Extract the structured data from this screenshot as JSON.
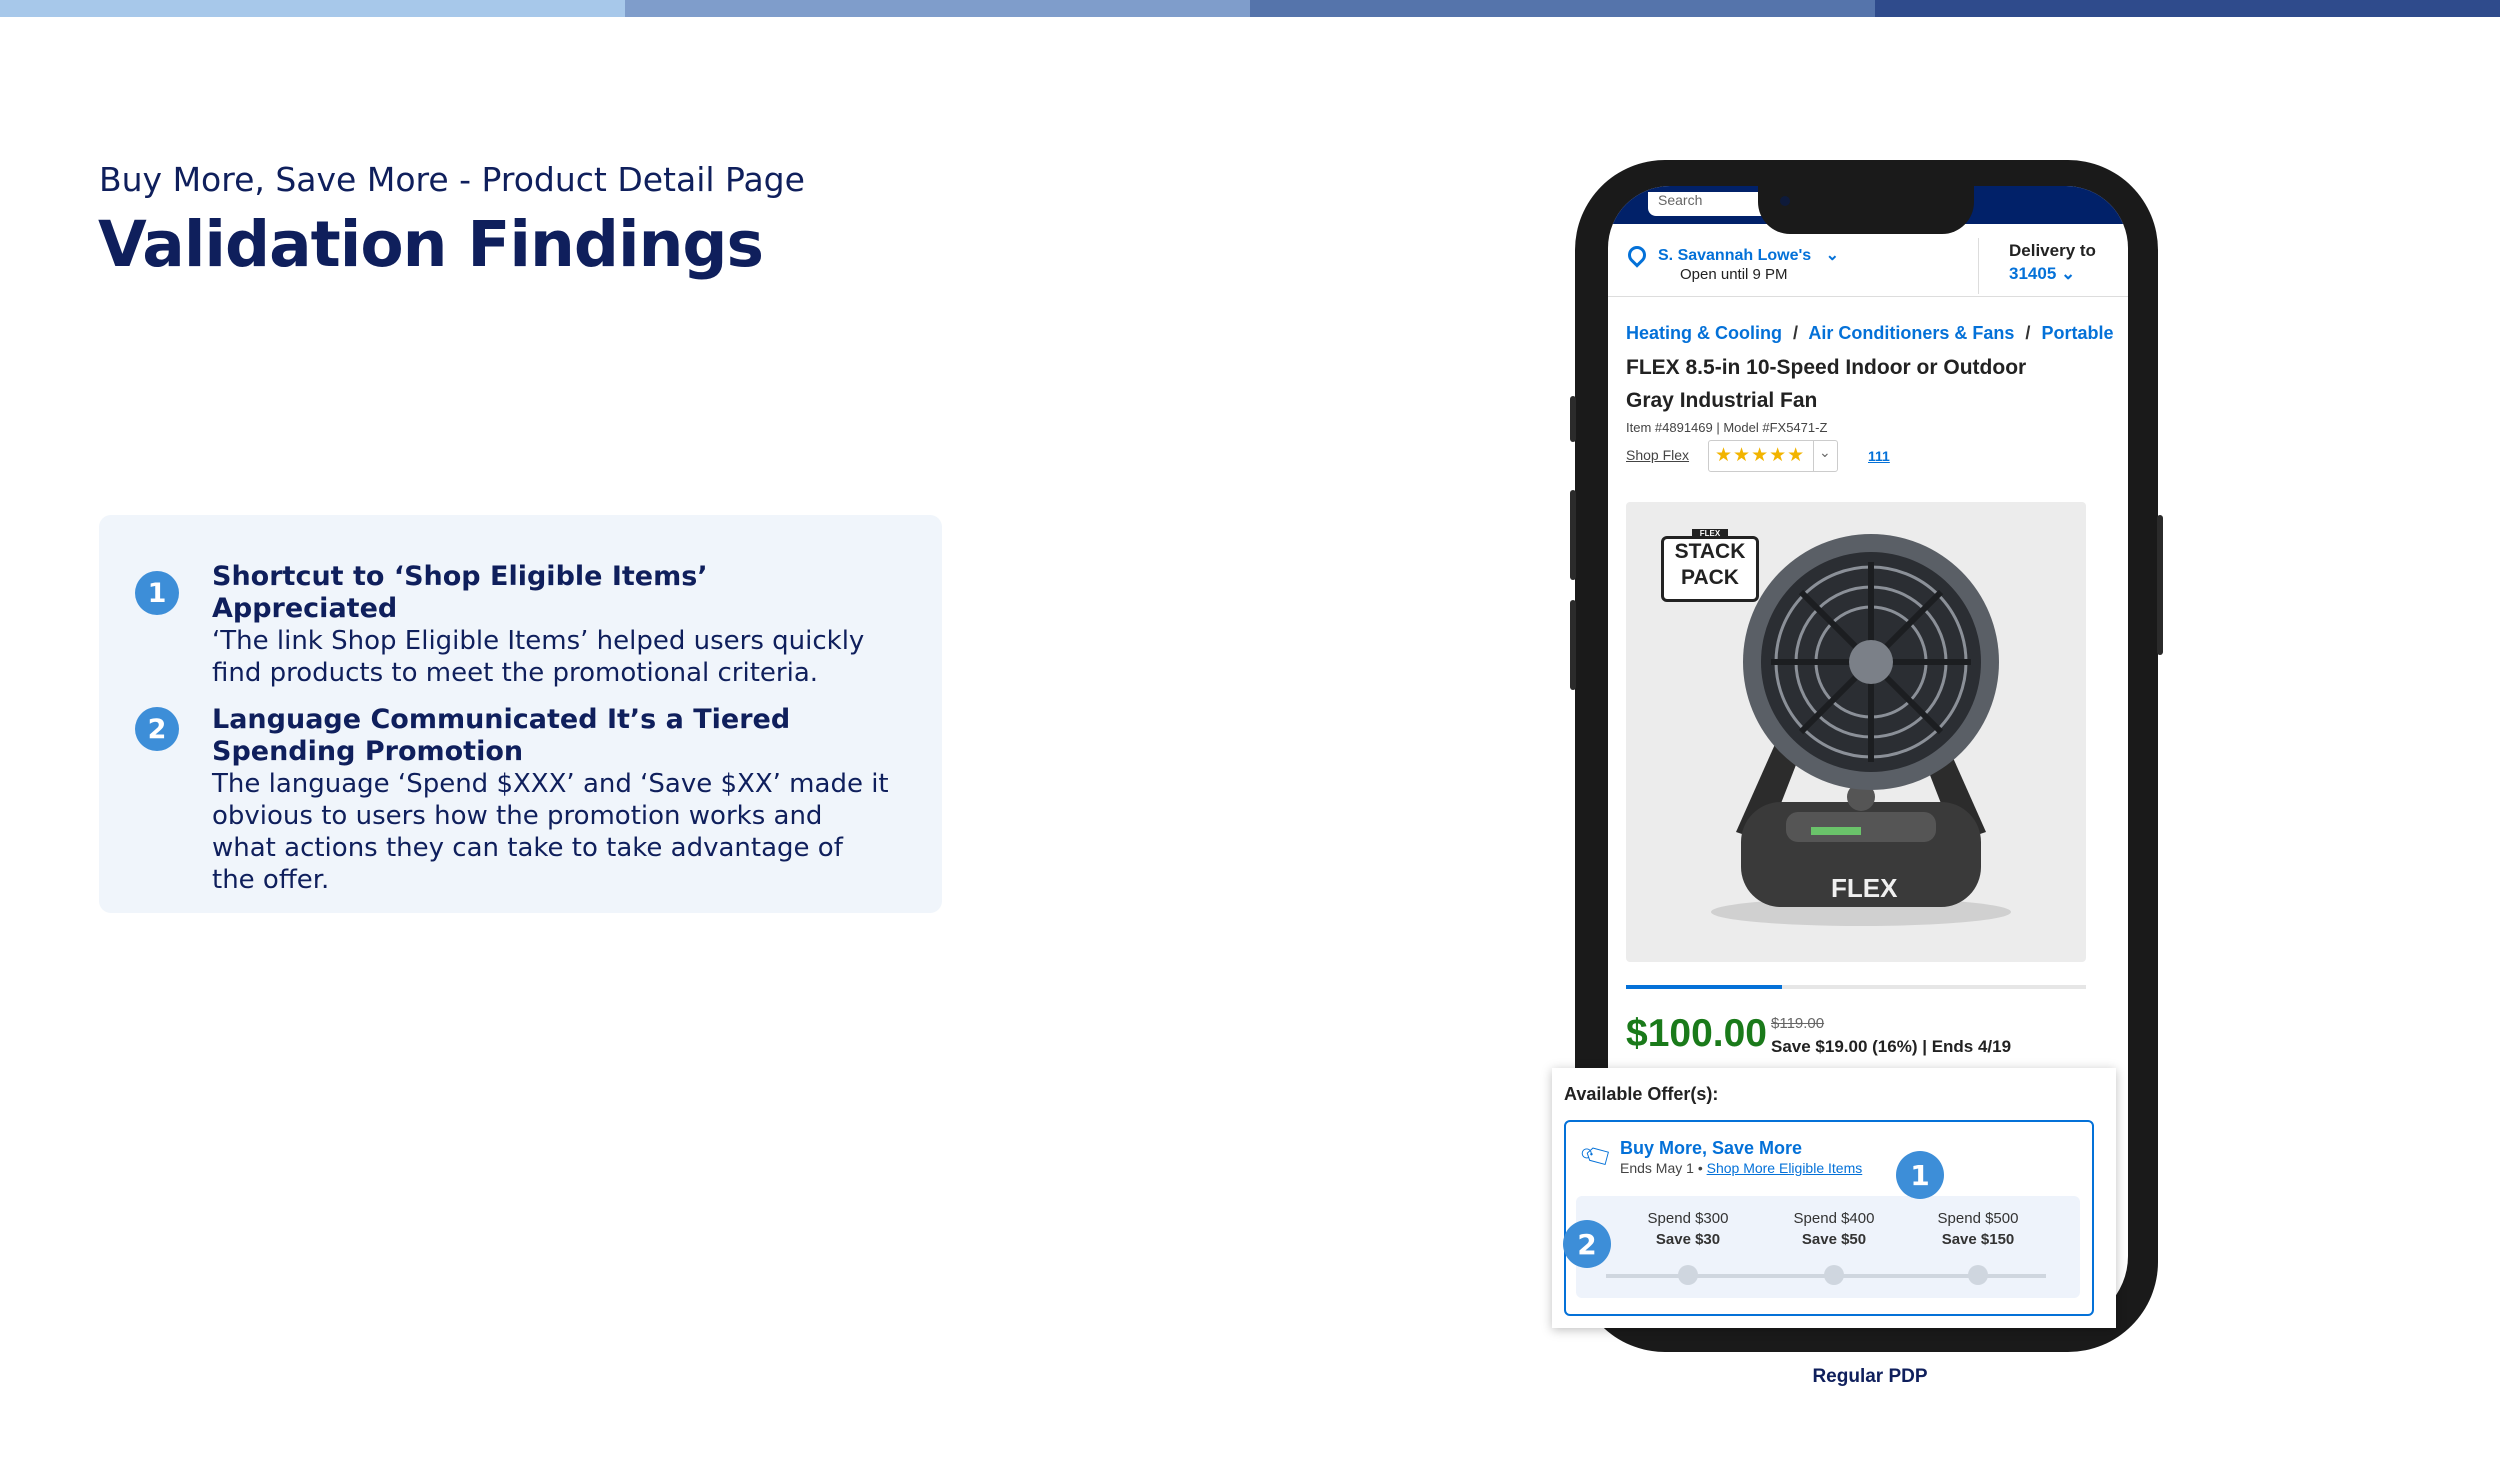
{
  "colors": {
    "bar": [
      "#a7c8ea",
      "#7f9dcb",
      "#5574ab",
      "#2f4b8c"
    ],
    "accent_blue": "#3d8ed8",
    "navy": "#0f1f5c",
    "price_green": "#1a7a1a",
    "link_blue": "#0471d8"
  },
  "header": {
    "subtitle": "Buy More, Save More - Product Detail Page",
    "title": "Validation Findings"
  },
  "findings": [
    {
      "number": "1",
      "title": "Shortcut to ‘Shop Eligible Items’ Appreciated",
      "body": "‘The link Shop Eligible Items’ helped users quickly find products to meet the promotional criteria."
    },
    {
      "number": "2",
      "title": "Language Communicated It’s a Tiered Spending Promotion",
      "body": "The language ‘Spend $XXX’ and ‘Save $XX’ made it obvious to users how the promotion works and what actions they can take to take advantage of the offer."
    }
  ],
  "phone": {
    "search_placeholder": "Search",
    "store": {
      "name": "S. Savannah Lowe's",
      "hours": "Open until 9 PM"
    },
    "delivery": {
      "label": "Delivery to",
      "zip": "31405"
    },
    "breadcrumb": [
      "Heating & Cooling",
      "Air Conditioners & Fans",
      "Portable"
    ],
    "breadcrumb_sep": "/",
    "product": {
      "title_line1": "FLEX 8.5-in 10-Speed Indoor or Outdoor",
      "title_line2": "Gray Industrial Fan",
      "meta": "Item #4891469 | Model #FX5471-Z",
      "brand_link": "Shop Flex",
      "rating_stars": 5,
      "review_count": "111",
      "badge_tag": "FLEX",
      "badge_line1": "STACK",
      "badge_line2": "PACK",
      "fan_brand": "FLEX",
      "image_progress": 0.34
    },
    "price": {
      "current": "$100.00",
      "was": "$119.00",
      "savings": "Save $19.00 (16%) | Ends 4/19"
    },
    "offers": {
      "heading": "Available Offer(s):",
      "title": "Buy More, Save More",
      "ends": "Ends May 1 •",
      "link": "Shop More Eligible Items",
      "tiers": [
        {
          "spend": "Spend $300",
          "save": "Save $30"
        },
        {
          "spend": "Spend $400",
          "save": "Save $50"
        },
        {
          "spend": "Spend $500",
          "save": "Save $150"
        }
      ]
    },
    "callouts": [
      "1",
      "2"
    ]
  },
  "caption": "Regular PDP"
}
